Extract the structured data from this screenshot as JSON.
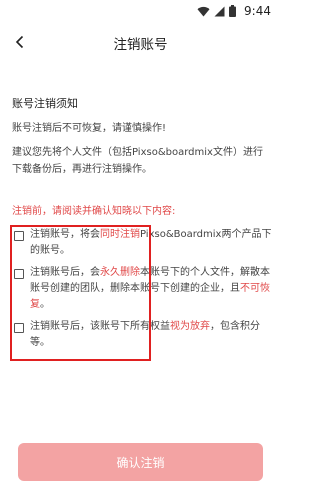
{
  "status_bar": {
    "time": "9:44"
  },
  "nav": {
    "title": "注销账号",
    "back_icon": "chevron-left-icon"
  },
  "notice": {
    "title": "账号注销须知",
    "paragraph1": "账号注销后不可恢复，请谨慎操作!",
    "paragraph2": "建议您先将个人文件（包括Pixso&boardmix文件）进行下载备份后，再进行注销操作。"
  },
  "warning": "注销前，请阅读并确认知晓以下内容:",
  "items": [
    {
      "checked": false,
      "parts": [
        {
          "text": "注销账号，将会",
          "red": false
        },
        {
          "text": "同时注销",
          "red": true
        },
        {
          "text": "Pixso&Boardmix两个产品下的账号。",
          "red": false
        }
      ]
    },
    {
      "checked": false,
      "parts": [
        {
          "text": "注销账号后，会",
          "red": false
        },
        {
          "text": "永久删除",
          "red": true
        },
        {
          "text": "本账号下的个人文件，解散本账号创建的团队，删除本账号下创建的企业，且",
          "red": false
        },
        {
          "text": "不可恢复",
          "red": true
        },
        {
          "text": "。",
          "red": false
        }
      ]
    },
    {
      "checked": false,
      "parts": [
        {
          "text": "注销账号后，该账号下所有权益",
          "red": false
        },
        {
          "text": "视为放弃",
          "red": true
        },
        {
          "text": "，包含积分等。",
          "red": false
        }
      ]
    }
  ],
  "confirm_button": {
    "label": "确认注销"
  },
  "colors": {
    "accent": "#e04848",
    "button": "#f3a3a3",
    "annotation_box": "#e02020"
  }
}
